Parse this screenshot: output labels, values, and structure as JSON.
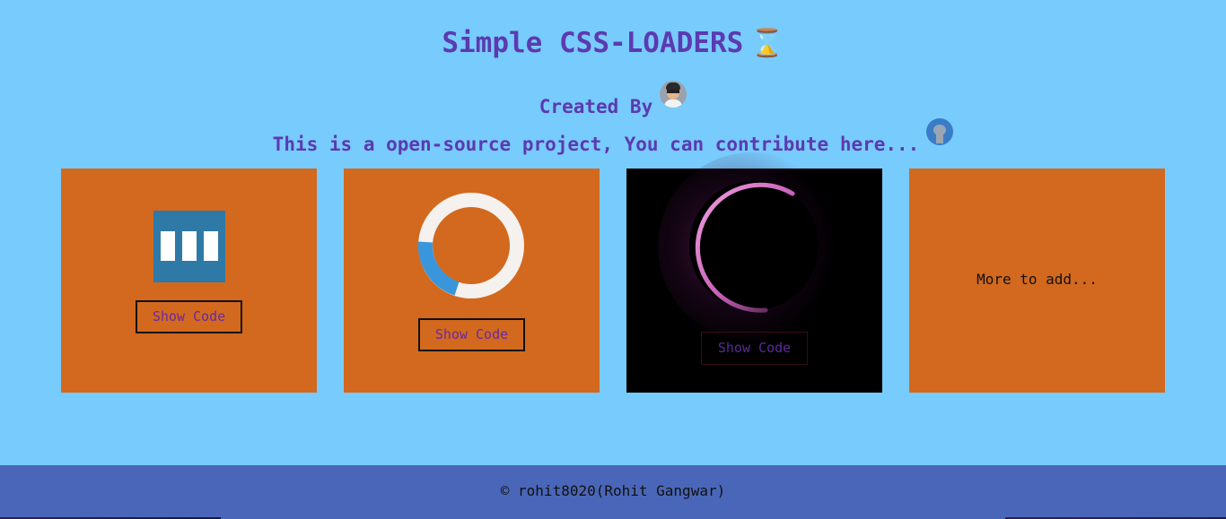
{
  "header": {
    "title": "Simple CSS-LOADERS",
    "title_icon": "⌛",
    "created_by": "Created By",
    "contribute": "This is a open-source project, You can contribute here..."
  },
  "cards": [
    {
      "button_label": "Show Code",
      "loader": "three-bars"
    },
    {
      "button_label": "Show Code",
      "loader": "ring-spinner"
    },
    {
      "button_label": "Show Code",
      "loader": "glow-ring"
    },
    {
      "text": "More to add..."
    }
  ],
  "footer": {
    "text": "© rohit8020(Rohit Gangwar)"
  },
  "colors": {
    "background": "#78cbfd",
    "heading": "#5b3ab0",
    "card": "#d2691e",
    "card_dark": "#000000",
    "loader_blue": "#2f79a7",
    "ring_blue": "#3a96da",
    "ring_track": "#f5f1ee",
    "glow_pink": "#e07ad0",
    "footer": "#4a66b8"
  },
  "icons": {
    "title": "hourglass-icon",
    "avatar": "author-avatar",
    "repo": "github-octocat-icon"
  }
}
